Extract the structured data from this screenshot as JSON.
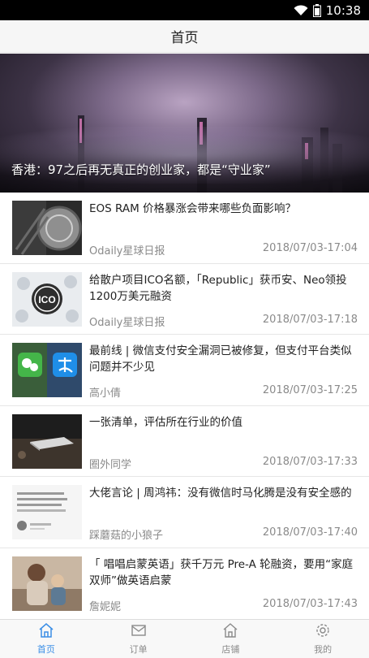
{
  "status_bar": {
    "time": "10:38"
  },
  "header": {
    "title": "首页"
  },
  "hero": {
    "caption": "香港：97之后再无真正的创业家，都是“守业家”"
  },
  "articles": [
    {
      "title": "EOS RAM 价格暴涨会带来哪些负面影响？",
      "author": "Odaily星球日报",
      "time": "2018/07/03-17:04"
    },
    {
      "title": "给散户项目ICO名额，「Republic」获币安、Neo领投1200万美元融资",
      "author": "Odaily星球日报",
      "time": "2018/07/03-17:18"
    },
    {
      "title": "最前线 | 微信支付安全漏洞已被修复，但支付平台类似问题并不少见",
      "author": "高小倩",
      "time": "2018/07/03-17:25"
    },
    {
      "title": "一张清单，评估所在行业的价值",
      "author": "圈外同学",
      "time": "2018/07/03-17:33"
    },
    {
      "title": "大佬言论 | 周鸿祎：没有微信时马化腾是没有安全感的",
      "author": "踩蘑菇的小狼子",
      "time": "2018/07/03-17:40"
    },
    {
      "title": "「 唱唱启蒙英语」获千万元 Pre-A 轮融资，要用“家庭双师”做英语启蒙",
      "author": "詹妮妮",
      "time": "2018/07/03-17:43"
    }
  ],
  "tabs": [
    {
      "label": "首页",
      "icon": "home-icon"
    },
    {
      "label": "订单",
      "icon": "mail-icon"
    },
    {
      "label": "店铺",
      "icon": "store-icon"
    },
    {
      "label": "我的",
      "icon": "gear-icon"
    }
  ],
  "colors": {
    "accent": "#3a8ee6",
    "muted": "#8a8a8a"
  }
}
